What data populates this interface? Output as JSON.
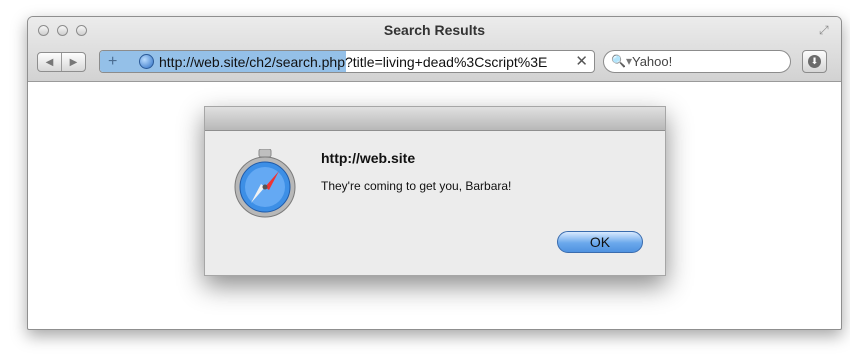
{
  "window": {
    "title": "Search Results"
  },
  "toolbar": {
    "url": "http://web.site/ch2/search.php?title=living+dead%3Cscript%3E",
    "search_placeholder": "Yahoo!",
    "back_glyph": "◀",
    "forward_glyph": "▶",
    "stop_glyph": "✕",
    "add_glyph": "+"
  },
  "dialog": {
    "host": "http://web.site",
    "message": "They're coming to get you, Barbara!",
    "ok_label": "OK"
  },
  "icons": [
    "search-icon",
    "globe-icon",
    "safari-compass-icon",
    "download-icon"
  ]
}
